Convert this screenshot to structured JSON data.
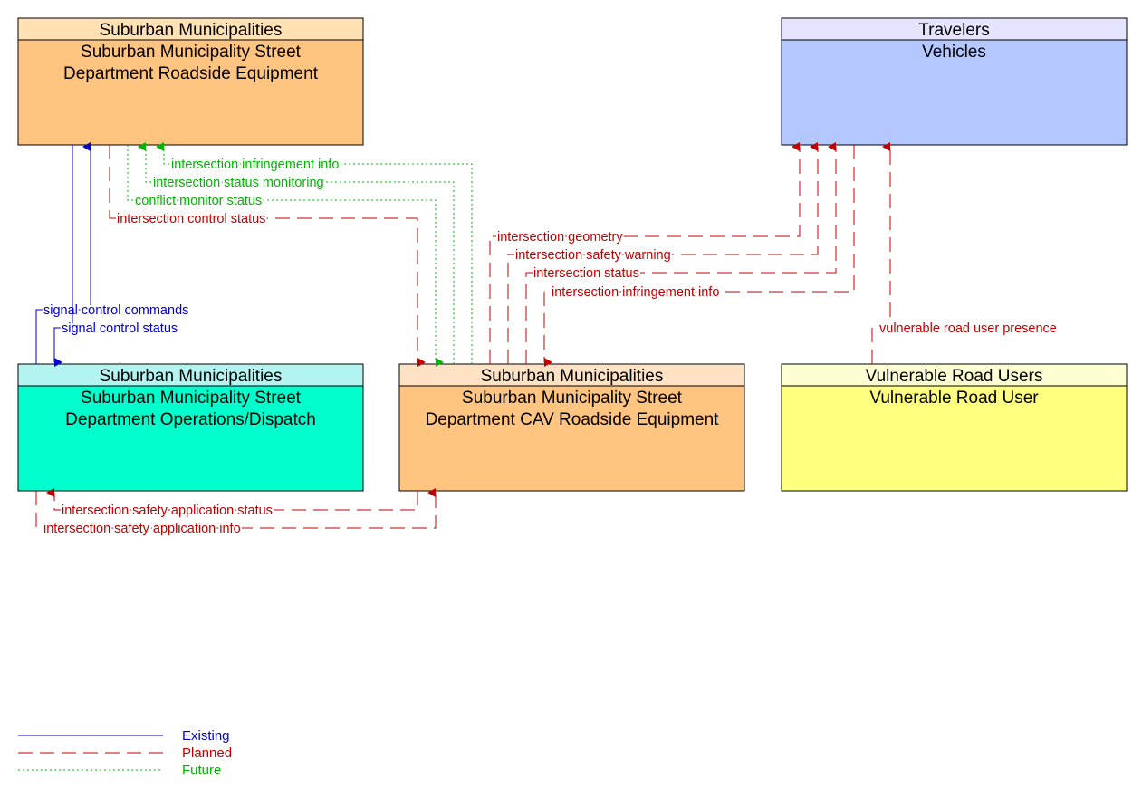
{
  "colors": {
    "existing": "#0000c8",
    "planned": "#c00000",
    "future": "#00b400"
  },
  "boxes": [
    {
      "id": "rse",
      "group": "Suburban Municipalities",
      "name": [
        "Suburban Municipality Street",
        "Department Roadside Equipment"
      ],
      "header_color": "#ffe1b4",
      "body_color": "#ffc480"
    },
    {
      "id": "veh",
      "group": "Travelers",
      "name": [
        "Vehicles"
      ],
      "header_color": "#e4e4ff",
      "body_color": "#b4c8ff"
    },
    {
      "id": "ops",
      "group": "Suburban Municipalities",
      "name": [
        "Suburban Municipality Street",
        "Department Operations/Dispatch"
      ],
      "header_color": "#b4f4f0",
      "body_color": "#00ffcc"
    },
    {
      "id": "cav",
      "group": "Suburban Municipalities",
      "name": [
        "Suburban Municipality Street",
        "Department CAV Roadside Equipment"
      ],
      "header_color": "#ffe1c4",
      "body_color": "#ffc480"
    },
    {
      "id": "vru",
      "group": "Vulnerable Road Users",
      "name": [
        "Vulnerable Road User"
      ],
      "header_color": "#ffffd4",
      "body_color": "#ffff80"
    }
  ],
  "flows": [
    {
      "label": "signal control commands",
      "status": "existing",
      "from": "ops",
      "to": "rse"
    },
    {
      "label": "signal control status",
      "status": "existing",
      "from": "rse",
      "to": "ops"
    },
    {
      "label": "intersection infringement info",
      "status": "future",
      "from": "cav",
      "to": "rse"
    },
    {
      "label": "intersection status monitoring",
      "status": "future",
      "from": "cav",
      "to": "rse"
    },
    {
      "label": "conflict monitor status",
      "status": "future",
      "from": "rse",
      "to": "cav"
    },
    {
      "label": "intersection control status",
      "status": "planned",
      "from": "rse",
      "to": "cav"
    },
    {
      "label": "intersection geometry",
      "status": "planned",
      "from": "cav",
      "to": "veh"
    },
    {
      "label": "intersection safety warning",
      "status": "planned",
      "from": "cav",
      "to": "veh"
    },
    {
      "label": "intersection status",
      "status": "planned",
      "from": "cav",
      "to": "veh"
    },
    {
      "label": "intersection infringement info",
      "status": "planned",
      "from": "veh",
      "to": "cav"
    },
    {
      "label": "vulnerable road user presence",
      "status": "planned",
      "from": "vru",
      "to": "veh"
    },
    {
      "label": "intersection safety application status",
      "status": "planned",
      "from": "cav",
      "to": "ops"
    },
    {
      "label": "intersection safety application info",
      "status": "planned",
      "from": "ops",
      "to": "cav"
    }
  ],
  "legend": [
    {
      "label": "Existing",
      "status": "existing"
    },
    {
      "label": "Planned",
      "status": "planned"
    },
    {
      "label": "Future",
      "status": "future"
    }
  ]
}
